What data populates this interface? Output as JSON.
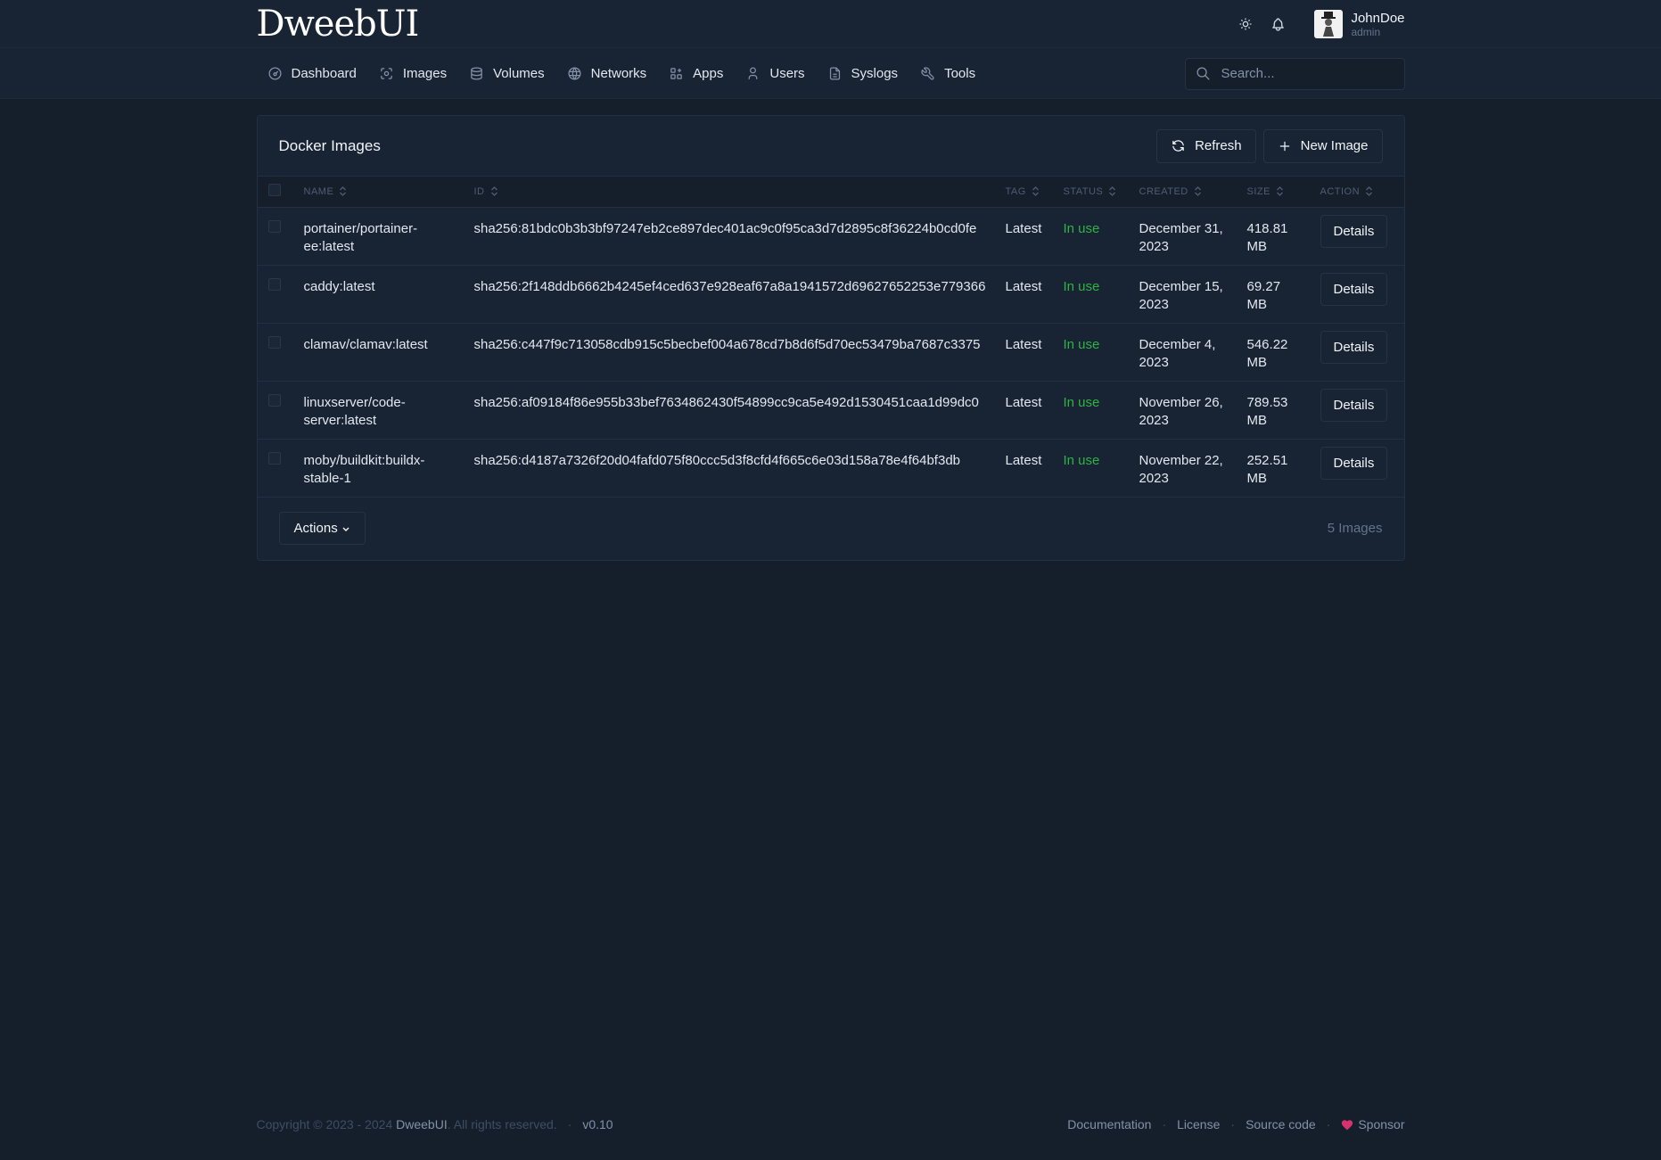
{
  "header": {
    "logo": "DweebUI",
    "user": {
      "name": "JohnDoe",
      "role": "admin"
    }
  },
  "nav": {
    "items": [
      {
        "label": "Dashboard",
        "icon": "dashboard-icon"
      },
      {
        "label": "Images",
        "icon": "images-icon"
      },
      {
        "label": "Volumes",
        "icon": "database-icon"
      },
      {
        "label": "Networks",
        "icon": "globe-icon"
      },
      {
        "label": "Apps",
        "icon": "apps-icon"
      },
      {
        "label": "Users",
        "icon": "user-icon"
      },
      {
        "label": "Syslogs",
        "icon": "file-icon"
      },
      {
        "label": "Tools",
        "icon": "tool-icon"
      }
    ],
    "search_placeholder": "Search..."
  },
  "card": {
    "title": "Docker Images",
    "refresh_label": "Refresh",
    "new_image_label": "New Image",
    "columns": [
      "NAME",
      "ID",
      "TAG",
      "STATUS",
      "CREATED",
      "SIZE",
      "ACTION"
    ],
    "rows": [
      {
        "name": "portainer/portainer-ee:latest",
        "id": "sha256:81bdc0b3b3bf97247eb2ce897dec401ac9c0f95ca3d7d2895c8f36224b0cd0fe",
        "tag": "Latest",
        "status": "In use",
        "created": "December 31, 2023",
        "size": "418.81 MB",
        "action": "Details"
      },
      {
        "name": "caddy:latest",
        "id": "sha256:2f148ddb6662b4245ef4ced637e928eaf67a8a1941572d69627652253e779366",
        "tag": "Latest",
        "status": "In use",
        "created": "December 15, 2023",
        "size": "69.27 MB",
        "action": "Details"
      },
      {
        "name": "clamav/clamav:latest",
        "id": "sha256:c447f9c713058cdb915c5becbef004a678cd7b8d6f5d70ec53479ba7687c3375",
        "tag": "Latest",
        "status": "In use",
        "created": "December 4, 2023",
        "size": "546.22 MB",
        "action": "Details"
      },
      {
        "name": "linuxserver/code-server:latest",
        "id": "sha256:af09184f86e955b33bef7634862430f54899cc9ca5e492d1530451caa1d99dc0",
        "tag": "Latest",
        "status": "In use",
        "created": "November 26, 2023",
        "size": "789.53 MB",
        "action": "Details"
      },
      {
        "name": "moby/buildkit:buildx-stable-1",
        "id": "sha256:d4187a7326f20d04fafd075f80ccc5d3f8cfd4f665c6e03d158a78e4f64bf3db",
        "tag": "Latest",
        "status": "In use",
        "created": "November 22, 2023",
        "size": "252.51 MB",
        "action": "Details"
      }
    ],
    "actions_label": "Actions",
    "count_label": "5 Images"
  },
  "footer": {
    "copyright_prefix": "Copyright © 2023 - 2024",
    "brand": "DweebUI",
    "rights": ". All rights reserved.",
    "version": "v0.10",
    "links": [
      "Documentation",
      "License",
      "Source code",
      "Sponsor"
    ]
  },
  "colors": {
    "background": "#151f2c",
    "surface": "#182333",
    "status_green": "#2fb344",
    "sponsor_heart": "#d6336c"
  }
}
